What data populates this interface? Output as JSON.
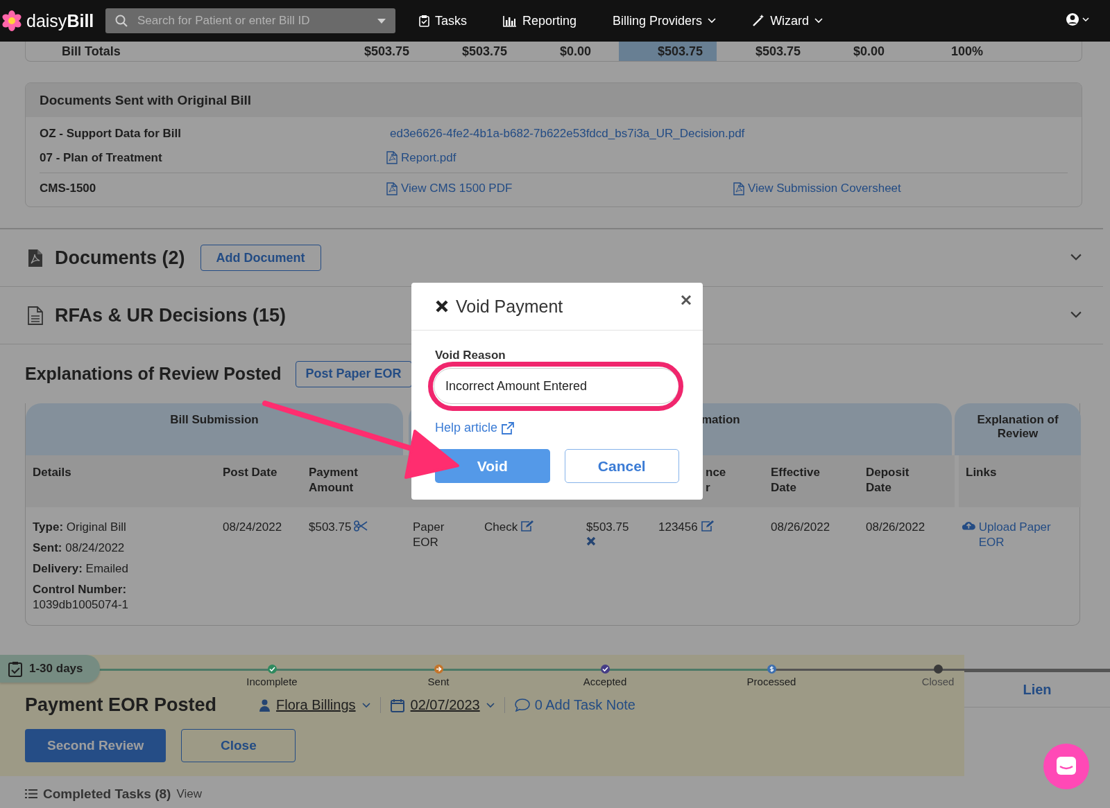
{
  "header": {
    "logo": "daisy**Bill**",
    "search": {
      "placeholder": "Search for Patient or enter Bill ID"
    },
    "nav": [
      {
        "label": "Tasks",
        "dropdown": false
      },
      {
        "label": "Reporting",
        "dropdown": false
      },
      {
        "label": "Billing Providers",
        "dropdown": true
      },
      {
        "label": "Wizard",
        "dropdown": true
      }
    ]
  },
  "bill_totals": {
    "label": "Bill Totals",
    "values": [
      {
        "text": "$503.75",
        "highlighted": false
      },
      {
        "text": "$503.75",
        "highlighted": false
      },
      {
        "text": "$0.00",
        "highlighted": false
      },
      {
        "text": "$503.75",
        "highlighted": true
      },
      {
        "text": "$503.75",
        "highlighted": false
      },
      {
        "text": "$0.00",
        "highlighted": false
      },
      {
        "text": "100%",
        "highlighted": false
      }
    ]
  },
  "documents_sent": {
    "title": "Documents Sent with Original Bill",
    "rows": [
      {
        "label": "OZ - Support Data for Bill",
        "links": [
          "ed3e6626-4fe2-4b1a-b682-7b622e53fdcd_bs7i3a_UR_Decision.pdf"
        ]
      },
      {
        "label": "07 - Plan of Treatment",
        "links": [
          "Report.pdf"
        ]
      },
      {
        "label": "CMS-1500",
        "links": [
          "View CMS 1500 PDF",
          "View Submission Coversheet"
        ]
      }
    ]
  },
  "sections": [
    {
      "kind": "documents",
      "title": "Documents (2)",
      "button": "Add Document"
    },
    {
      "kind": "rfas",
      "title": "RFAs & UR Decisions (15)"
    }
  ],
  "eor": {
    "title": "Explanations of Review Posted",
    "button": "Post Paper EOR",
    "groups": [
      "Bill Submission",
      "mation",
      "Explanation of Review"
    ],
    "columns": [
      "Details",
      "Post Date",
      "Payment Amount",
      "nce\nr",
      "Effective Date",
      "Deposit Date",
      "Links"
    ],
    "row": [
      {
        "kind": "details",
        "lines": [
          "**Type:** Original Bill",
          "**Sent:** 08/24/2022",
          "**Delivery:** Emailed",
          "**Control Number:** 1039db1005074-1"
        ]
      },
      {
        "kind": "text",
        "text": "08/24/2022"
      },
      {
        "kind": "split",
        "text": "$503.75"
      },
      {
        "kind": "text",
        "text": "Paper EOR"
      },
      {
        "kind": "editable",
        "text": "Check"
      },
      {
        "kind": "voidable",
        "text": "$503.75"
      },
      {
        "kind": "editable",
        "text": "123456"
      },
      {
        "kind": "text",
        "text": "08/26/2022"
      },
      {
        "kind": "text",
        "text": "08/26/2022"
      },
      {
        "kind": "upload",
        "text": "Upload Paper EOR"
      }
    ]
  },
  "task_bar": {
    "age": "1-30 days",
    "steps": [
      {
        "label": "Incomplete",
        "done": true,
        "color": "#2f8a5f"
      },
      {
        "label": "Sent",
        "done": true,
        "color": "#c4742a"
      },
      {
        "label": "Accepted",
        "done": true,
        "color": "#463d86"
      },
      {
        "label": "Processed",
        "done": true,
        "color": "#3e6fae"
      },
      {
        "label": "Closed",
        "done": false,
        "color": "#3a3a3a"
      }
    ],
    "title": "Payment EOR Posted",
    "assignee": "Flora Billings",
    "date": "02/07/2023",
    "note": "0 Add Task Note",
    "buttons": [
      {
        "label": "Second Review",
        "kind": "primary"
      },
      {
        "label": "Close",
        "kind": "secondary"
      }
    ],
    "side_tab": "Lien"
  },
  "completed_tasks": {
    "label": "Completed Tasks (8)",
    "link": "View"
  },
  "modal": {
    "title": "Void Payment",
    "field_label": "Void Reason",
    "value": "Incorrect Amount Entered",
    "help": "Help article",
    "buttons": [
      {
        "label": "Void",
        "kind": "primary"
      },
      {
        "label": "Cancel",
        "kind": "secondary"
      }
    ]
  }
}
